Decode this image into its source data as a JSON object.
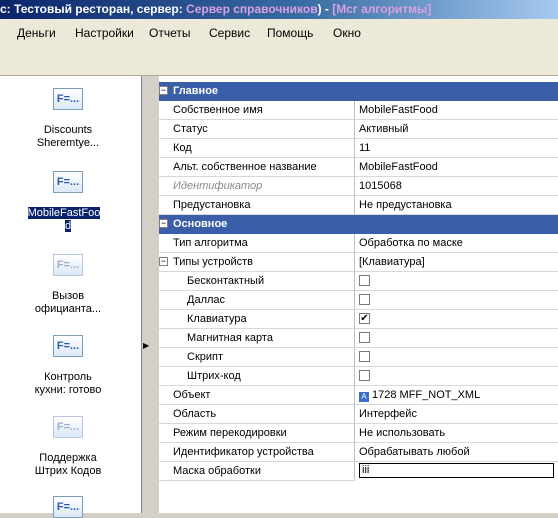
{
  "window": {
    "title_prefix": "с: Тестовый ресторан, сервер: ",
    "title_server": "Сервер справочников",
    "title_middle": ") - ",
    "title_section": "[Мсг алгоритмы]"
  },
  "menu": [
    {
      "label": "Деньги"
    },
    {
      "label": "Настройки"
    },
    {
      "label": "Отчеты"
    },
    {
      "label": "Сервис"
    },
    {
      "label": "Помощь"
    },
    {
      "label": "Окно"
    }
  ],
  "left_pane": {
    "items": [
      {
        "icon": "F=...",
        "label1": "Discounts",
        "label2": "Sheremtye...",
        "selected": false,
        "faded": false
      },
      {
        "icon": "F=...",
        "label1": "MobileFastFoo",
        "label2": "d",
        "selected": true,
        "faded": false
      },
      {
        "icon": "F=...",
        "label1": "Вызов",
        "label2": "официанта...",
        "selected": false,
        "faded": true
      },
      {
        "icon": "F=...",
        "label1": "Контроль",
        "label2": "кухни: готово",
        "selected": false,
        "faded": false
      },
      {
        "icon": "F=...",
        "label1": "Поддержка",
        "label2": "Штрих Кодов",
        "selected": false,
        "faded": true
      },
      {
        "icon": "F=...",
        "label1": "",
        "label2": "",
        "selected": false,
        "faded": false
      }
    ]
  },
  "properties": {
    "cat_main": "Главное",
    "own_name_label": "Собственное имя",
    "own_name_value": "MobileFastFood",
    "status_label": "Статус",
    "status_value": "Активный",
    "code_label": "Код",
    "code_value": "11",
    "alt_name_label": "Альт. собственное название",
    "alt_name_value": "MobileFastFood",
    "id_label": "Идентификатор",
    "id_value": "1015068",
    "preset_label": "Предустановка",
    "preset_value": "Не предустановка",
    "cat_basic": "Основное",
    "algo_type_label": "Тип алгоритма",
    "algo_type_value": "Обработка по маске",
    "device_types_label": "Типы устройств",
    "device_types_value": "[Клавиатура]",
    "devices": [
      {
        "label": "Бесконтактный",
        "checked": false
      },
      {
        "label": "Даллас",
        "checked": false
      },
      {
        "label": "Клавиатура",
        "checked": true
      },
      {
        "label": "Магнитная карта",
        "checked": false
      },
      {
        "label": "Скрипт",
        "checked": false
      },
      {
        "label": "Штрих-код",
        "checked": false
      }
    ],
    "object_label": "Объект",
    "object_icon": "A",
    "object_value": "1728 MFF_NOT_XML",
    "area_label": "Область",
    "area_value": "Интерфейс",
    "recode_label": "Режим перекодировки",
    "recode_value": "Не использовать",
    "device_id_label": "Идентификатор устройства",
    "device_id_value": "Обрабатывать любой",
    "mask_label": "Маска обработки",
    "mask_value": "iii"
  }
}
